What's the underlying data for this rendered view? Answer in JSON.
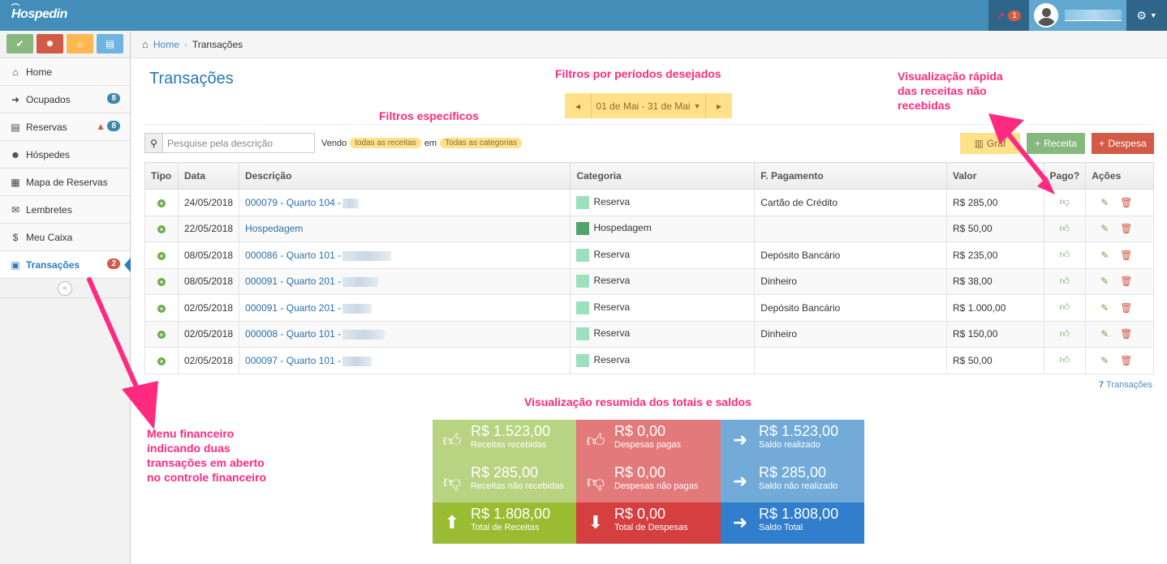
{
  "topbar": {
    "logo": "Hospedin",
    "notif_count": "1"
  },
  "sidebar": {
    "items": [
      {
        "label": "Home",
        "icon": "home-icon"
      },
      {
        "label": "Ocupados",
        "icon": "sign-in-icon",
        "badge": "8"
      },
      {
        "label": "Reservas",
        "icon": "book-icon",
        "badge": "8",
        "warning": true
      },
      {
        "label": "Hóspedes",
        "icon": "users-icon"
      },
      {
        "label": "Mapa de Reservas",
        "icon": "calendar-icon"
      },
      {
        "label": "Lembretes",
        "icon": "envelope-icon"
      },
      {
        "label": "Meu Caixa",
        "icon": "dollar-icon"
      },
      {
        "label": "Transações",
        "icon": "money-icon",
        "badge": "2",
        "active": true
      }
    ]
  },
  "breadcrumb": {
    "home": "Home",
    "current": "Transações"
  },
  "page": {
    "title": "Transações",
    "date_range": "01 de Mai - 31 de Mai",
    "search_placeholder": "Pesquise pela descrição",
    "filter_prefix": "Vendo",
    "filter_type": "todas as receitas",
    "filter_mid": "em",
    "filter_category": "Todas as categorias",
    "btn_graf": "Gráf",
    "btn_receita": "Receita",
    "btn_despesa": "Despesa"
  },
  "table": {
    "headers": {
      "tipo": "Tipo",
      "data": "Data",
      "descricao": "Descrição",
      "categoria": "Categoria",
      "pagamento": "F. Pagamento",
      "valor": "Valor",
      "pago": "Pago?",
      "acoes": "Ações"
    },
    "rows": [
      {
        "data": "24/05/2018",
        "descricao": "000079 - Quarto 104 -",
        "categoria": "Reserva",
        "pagamento": "Cartão de Crédito",
        "valor": "R$ 285,00",
        "pago": false
      },
      {
        "data": "22/05/2018",
        "descricao": "Hospedagem",
        "categoria": "Hospedagem",
        "pagamento": "",
        "valor": "R$ 50,00",
        "pago": true
      },
      {
        "data": "08/05/2018",
        "descricao": "000086 - Quarto 101 -",
        "categoria": "Reserva",
        "pagamento": "Depósito Bancário",
        "valor": "R$ 235,00",
        "pago": true
      },
      {
        "data": "08/05/2018",
        "descricao": "000091 - Quarto 201 -",
        "categoria": "Reserva",
        "pagamento": "Dinheiro",
        "valor": "R$ 38,00",
        "pago": true
      },
      {
        "data": "02/05/2018",
        "descricao": "000091 - Quarto 201 -",
        "categoria": "Reserva",
        "pagamento": "Depósito Bancário",
        "valor": "R$ 1.000,00",
        "pago": true
      },
      {
        "data": "02/05/2018",
        "descricao": "000008 - Quarto 101 -",
        "categoria": "Reserva",
        "pagamento": "Dinheiro",
        "valor": "R$ 150,00",
        "pago": true
      },
      {
        "data": "02/05/2018",
        "descricao": "000097 - Quarto 101 -",
        "categoria": "Reserva",
        "pagamento": "",
        "valor": "R$ 50,00",
        "pago": true
      }
    ],
    "count_number": "7",
    "count_label": "Transações"
  },
  "summary": {
    "receitas_recebidas": {
      "value": "R$ 1.523,00",
      "label": "Receitas recebidas"
    },
    "receitas_nao_recebidas": {
      "value": "R$ 285,00",
      "label": "Receitas não recebidas"
    },
    "total_receitas": {
      "value": "R$ 1.808,00",
      "label": "Total de Receitas"
    },
    "despesas_pagas": {
      "value": "R$ 0,00",
      "label": "Despesas pagas"
    },
    "despesas_nao_pagas": {
      "value": "R$ 0,00",
      "label": "Despesas não pagas"
    },
    "total_despesas": {
      "value": "R$ 0,00",
      "label": "Total de Despesas"
    },
    "saldo_realizado": {
      "value": "R$ 1.523,00",
      "label": "Saldo realizado"
    },
    "saldo_nao_realizado": {
      "value": "R$ 285,00",
      "label": "Saldo não realizado"
    },
    "saldo_total": {
      "value": "R$ 1.808,00",
      "label": "Saldo Total"
    }
  },
  "annotations": {
    "periodos": "Filtros por períodos desejados",
    "especificos": "Filtros específicos",
    "rapida_1": "Visualização rápida",
    "rapida_2": "das receitas não",
    "rapida_3": "recebidas",
    "resumida": "Visualização resumida dos totais e saldos",
    "menu_1": "Menu financeiro",
    "menu_2": "indicando duas",
    "menu_3": "transações em aberto",
    "menu_4": "no controle financeiro"
  },
  "colors": {
    "topbar": "#438eb9",
    "accent": "#2679b5",
    "annotation": "#ff2a7f"
  }
}
